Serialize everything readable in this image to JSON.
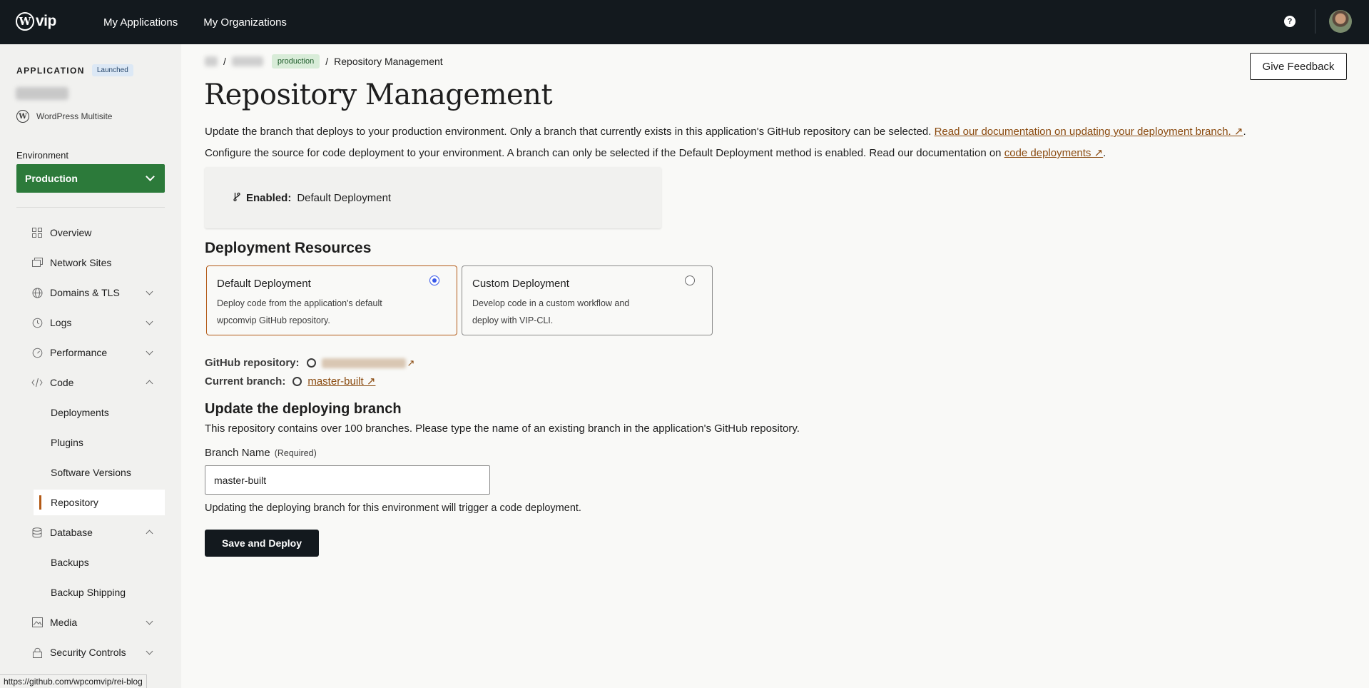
{
  "topbar": {
    "logo_text": "vip",
    "nav": [
      "My Applications",
      "My Organizations"
    ],
    "help_glyph": "?"
  },
  "sidebar": {
    "app_label": "APPLICATION",
    "launched": "Launched",
    "app_type": "WordPress Multisite",
    "env_label": "Environment",
    "env_value": "Production",
    "items": [
      {
        "label": "Overview",
        "icon": "grid-icon"
      },
      {
        "label": "Network Sites",
        "icon": "sites-icon"
      },
      {
        "label": "Domains & TLS",
        "icon": "globe-icon"
      },
      {
        "label": "Logs",
        "icon": "history-icon"
      },
      {
        "label": "Performance",
        "icon": "gauge-icon"
      },
      {
        "label": "Code",
        "icon": "code-icon"
      },
      {
        "label": "Database",
        "icon": "database-icon"
      },
      {
        "label": "Media",
        "icon": "media-icon"
      },
      {
        "label": "Security Controls",
        "icon": "lock-icon"
      }
    ],
    "code_sub": [
      "Deployments",
      "Plugins",
      "Software Versions",
      "Repository"
    ],
    "database_sub": [
      "Backups",
      "Backup Shipping"
    ]
  },
  "status_url": "https://github.com/wpcomvip/rei-blog",
  "breadcrumb": {
    "sep": "/",
    "env_badge": "production",
    "current": "Repository Management"
  },
  "feedback_label": "Give Feedback",
  "page_title": "Repository Management",
  "desc1": {
    "text": "Update the branch that deploys to your production environment. Only a branch that currently exists in this application's GitHub repository can be selected. ",
    "link": "Read our documentation on updating your deployment branch. ↗",
    "suffix": "."
  },
  "desc2": {
    "text": "Configure the source for code deployment to your environment. A branch can only be selected if the Default Deployment method is enabled. Read our documentation on ",
    "link": "code deployments ↗",
    "suffix": "."
  },
  "enabled": {
    "label": "Enabled:",
    "value": "Default Deployment"
  },
  "resources": {
    "heading": "Deployment Resources",
    "options": [
      {
        "title": "Default Deployment",
        "desc": "Deploy code from the application's default wpcomvip GitHub repository.",
        "selected": true
      },
      {
        "title": "Custom Deployment",
        "desc": "Develop code in a custom workflow and deploy with VIP-CLI.",
        "selected": false
      }
    ]
  },
  "repo": {
    "gh_label": "GitHub repository:",
    "gh_arrow": "↗",
    "branch_label": "Current branch:",
    "branch_value": "master-built ↗"
  },
  "update": {
    "heading": "Update the deploying branch",
    "desc": "This repository contains over 100 branches. Please type the name of an existing branch in the application's GitHub repository.",
    "field_label": "Branch Name",
    "required": "(Required)",
    "input_value": "master-built",
    "note": "Updating the deploying branch for this environment will trigger a code deployment.",
    "submit": "Save and Deploy"
  }
}
